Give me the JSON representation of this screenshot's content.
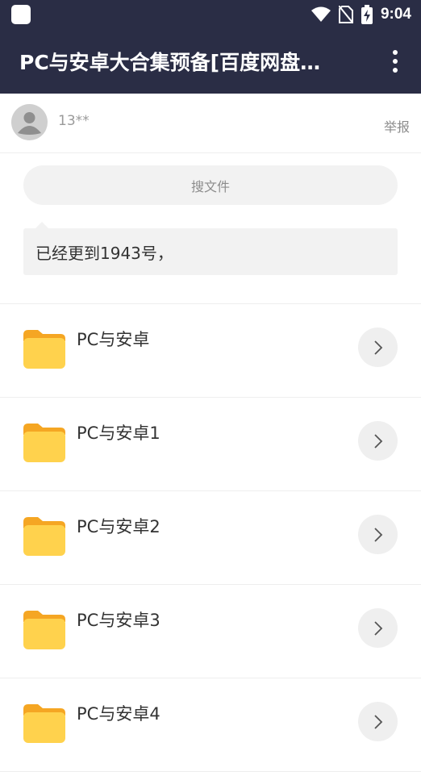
{
  "status_bar": {
    "time": "9:04",
    "icons": [
      "app-icon",
      "wifi-icon",
      "no-sim-icon",
      "battery-charging-icon"
    ]
  },
  "app_bar": {
    "title": "PC与安卓大合集预备[百度网盘…",
    "menu_icon": "more-vert-icon"
  },
  "user": {
    "name": "13**",
    "report_label": "举报",
    "avatar_icon": "person-avatar-icon"
  },
  "search": {
    "label": "搜文件"
  },
  "notice": {
    "text": "已经更到1943号，"
  },
  "folders": [
    {
      "name": "PC与安卓"
    },
    {
      "name": "PC与安卓1"
    },
    {
      "name": "PC与安卓2"
    },
    {
      "name": "PC与安卓3"
    },
    {
      "name": "PC与安卓4"
    }
  ],
  "colors": {
    "bar_bg": "#2a2d45",
    "folder_yellow": "#ffd24d",
    "folder_tab": "#f5a623"
  }
}
